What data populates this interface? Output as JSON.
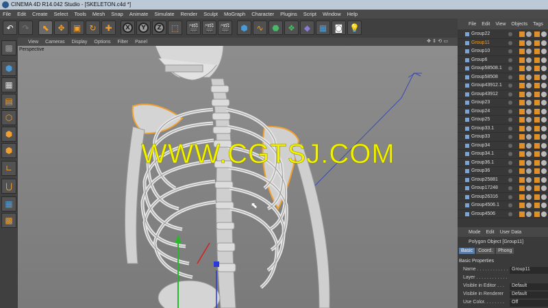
{
  "window": {
    "title": "CINEMA 4D R14.042 Studio - [SKELETON.c4d *]"
  },
  "menubar": [
    "File",
    "Edit",
    "Create",
    "Select",
    "Tools",
    "Mesh",
    "Snap",
    "Animate",
    "Simulate",
    "Render",
    "Sculpt",
    "MoGraph",
    "Character",
    "Plugins",
    "Script",
    "Window",
    "Help"
  ],
  "toolbar": {
    "x_label": "X",
    "y_label": "Y",
    "z_label": "Z"
  },
  "viewport": {
    "menu": [
      "View",
      "Cameras",
      "Display",
      "Options",
      "Filter",
      "Panel"
    ],
    "camera_label": "Perspective",
    "watermark": "WWW.CGTSJ.COM"
  },
  "object_manager": {
    "menu": [
      "File",
      "Edit",
      "View",
      "Objects",
      "Tags"
    ],
    "objects": [
      "Group22",
      "Group11",
      "Group10",
      "Group6",
      "Group58508.1",
      "Group58508",
      "Group43912.1",
      "Group43912",
      "Group23",
      "Group24",
      "Group25",
      "Group33.1",
      "Group33",
      "Group34",
      "Group34.1",
      "Group36.1",
      "Group36",
      "Group25881",
      "Group17248",
      "Group26316",
      "Group4506.1",
      "Group4506"
    ],
    "selected": "Group11"
  },
  "attribute_manager": {
    "menu": [
      "Mode",
      "Edit",
      "User Data"
    ],
    "object_title": "Polygon Object [Group11]",
    "tabs": [
      "Basic",
      "Coord.",
      "Phong"
    ],
    "active_tab": "Basic",
    "section": "Basic Properties",
    "rows": [
      {
        "label": "Name . . . . . . . . . . . .",
        "value": "Group11"
      },
      {
        "label": "Layer . . . . . . . . . . . .",
        "value": ""
      },
      {
        "label": "Visible in Editor . . .",
        "value": "Default"
      },
      {
        "label": "Visible in Renderer",
        "value": "Default"
      },
      {
        "label": "Use Color. . . . . . . .",
        "value": "Off"
      }
    ]
  },
  "colors": {
    "accent_selected": "#f0a030",
    "watermark": "#f3f300",
    "viewport_bg": "#8a8a8a",
    "tab_active": "#5b7fa8"
  }
}
